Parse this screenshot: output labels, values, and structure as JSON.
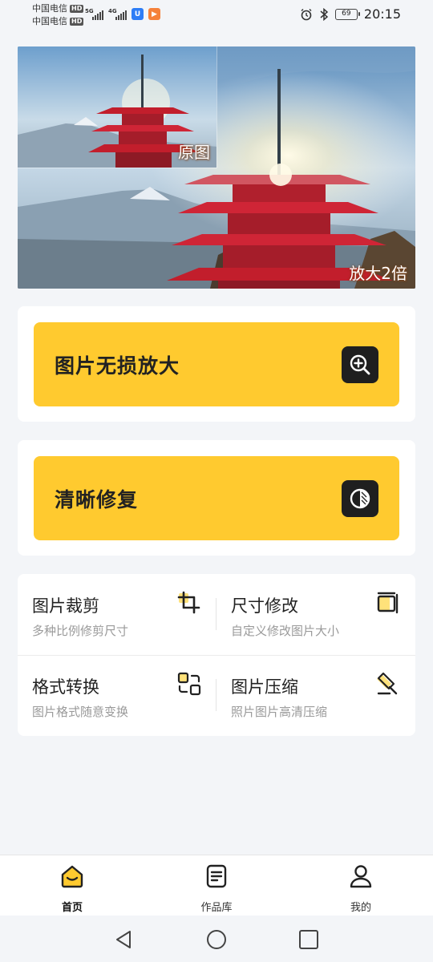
{
  "status_bar": {
    "carrier1": "中国电信",
    "carrier2": "中国电信",
    "hd": "HD",
    "signal1_gen": "5G",
    "signal2_gen": "4G",
    "battery": "69",
    "time": "20:15"
  },
  "hero": {
    "original_label": "原图",
    "zoom_label": "放大2倍"
  },
  "features": [
    {
      "title": "图片无损放大",
      "icon": "zoom-in-icon"
    },
    {
      "title": "清晰修复",
      "icon": "contrast-icon"
    }
  ],
  "tools": [
    {
      "title": "图片裁剪",
      "subtitle": "多种比例修剪尺寸",
      "icon": "crop-icon"
    },
    {
      "title": "尺寸修改",
      "subtitle": "自定义修改图片大小",
      "icon": "resize-icon"
    },
    {
      "title": "格式转换",
      "subtitle": "图片格式随意变换",
      "icon": "format-convert-icon"
    },
    {
      "title": "图片压缩",
      "subtitle": "照片图片高清压缩",
      "icon": "compress-icon"
    }
  ],
  "bottom_nav": [
    {
      "label": "首页",
      "icon": "home-icon",
      "active": true
    },
    {
      "label": "作品库",
      "icon": "gallery-icon",
      "active": false
    },
    {
      "label": "我的",
      "icon": "profile-icon",
      "active": false
    }
  ],
  "colors": {
    "accent": "#ffca2f",
    "icon_dark": "#1f1f1f",
    "background": "#f3f5f8"
  }
}
